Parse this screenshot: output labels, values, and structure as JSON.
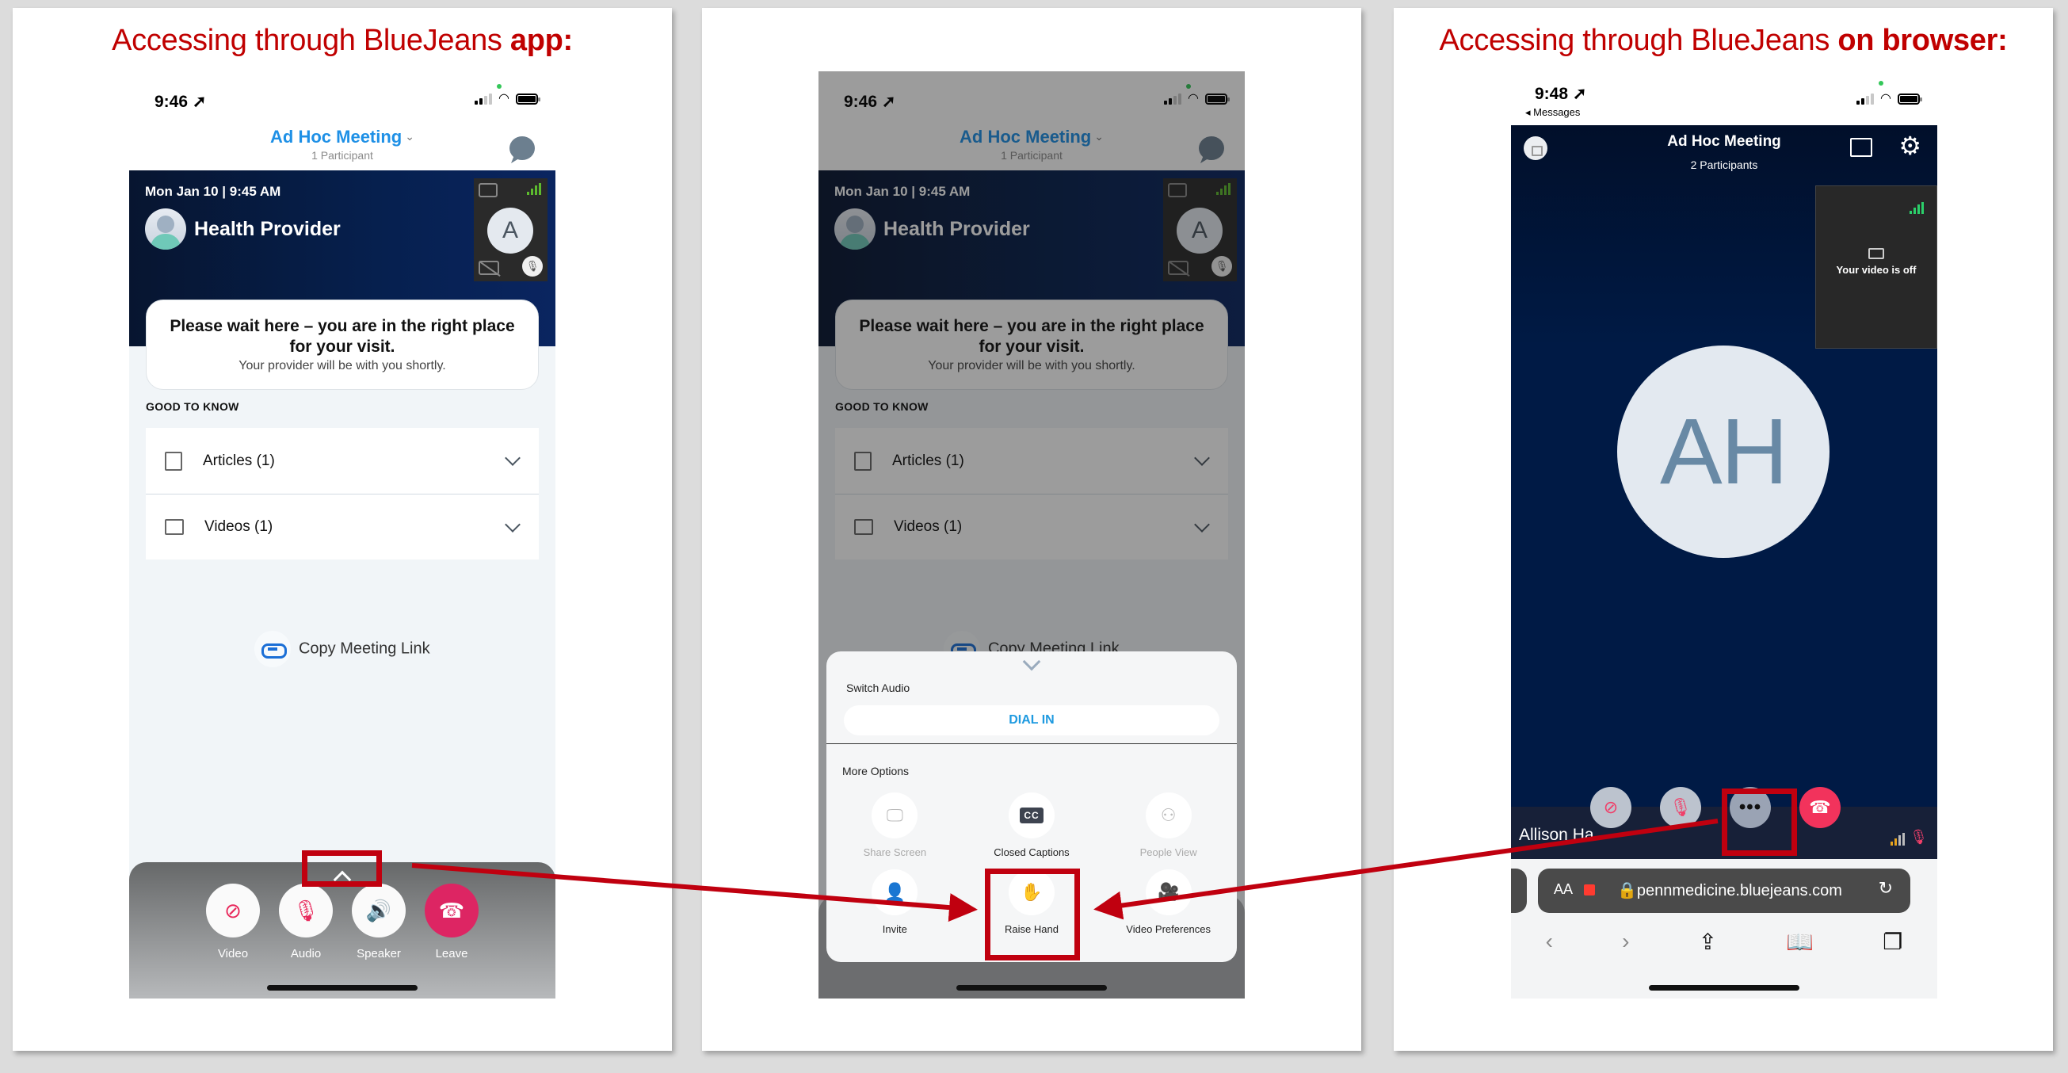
{
  "colors": {
    "annotation_red": "#c0000f",
    "link_blue": "#1e90e6",
    "leave_pink": "#dd2563",
    "meeting_navy": "#001a45"
  },
  "panels": [
    {
      "heading_regular": "Accessing through BlueJeans ",
      "heading_bold": "app:",
      "status": {
        "time": "9:46 ➚"
      },
      "header": {
        "title": "Ad Hoc Meeting",
        "participants": "1 Participant"
      },
      "video": {
        "date": "Mon Jan 10 | 9:45 AM",
        "provider_name": "Health Provider",
        "self_initial": "A"
      },
      "wait_card": {
        "title": "Please wait here – you are in the right place for your visit.",
        "subtitle": "Your provider will be with you shortly."
      },
      "good_to_know": {
        "label": "GOOD TO KNOW",
        "items": [
          {
            "icon": "article-icon",
            "label": "Articles (1)"
          },
          {
            "icon": "video-icon",
            "label": "Videos (1)"
          }
        ]
      },
      "copy_link": "Copy Meeting Link",
      "controls": [
        {
          "icon": "video-off-icon",
          "label": "Video"
        },
        {
          "icon": "mic-off-icon",
          "label": "Audio"
        },
        {
          "icon": "speaker-icon",
          "label": "Speaker"
        },
        {
          "icon": "hang-up-icon",
          "label": "Leave"
        }
      ]
    },
    {
      "heading_regular": "",
      "heading_bold": "",
      "status": {
        "time": "9:46 ➚"
      },
      "header": {
        "title": "Ad Hoc Meeting",
        "participants": "1 Participant"
      },
      "video": {
        "date": "Mon Jan 10 | 9:45 AM",
        "provider_name": "Health Provider",
        "self_initial": "A"
      },
      "wait_card": {
        "title": "Please wait here – you are in the right place for your visit.",
        "subtitle": "Your provider will be with you shortly."
      },
      "good_to_know": {
        "label": "GOOD TO KNOW",
        "items": [
          {
            "icon": "article-icon",
            "label": "Articles (1)"
          },
          {
            "icon": "video-icon",
            "label": "Videos (1)"
          }
        ]
      },
      "copy_link": "Copy Meeting Link",
      "sheet": {
        "switch_audio_label": "Switch Audio",
        "dial_in": "DIAL IN",
        "more_options_label": "More Options",
        "options": [
          {
            "icon": "share-screen-icon",
            "label": "Share Screen",
            "enabled": false
          },
          {
            "icon": "closed-captions-icon",
            "label": "Closed Captions",
            "enabled": true,
            "glyph": "CC"
          },
          {
            "icon": "people-view-icon",
            "label": "People View",
            "enabled": false
          },
          {
            "icon": "invite-icon",
            "label": "Invite",
            "enabled": true
          },
          {
            "icon": "raise-hand-icon",
            "label": "Raise Hand",
            "enabled": true,
            "highlighted": true
          },
          {
            "icon": "video-preferences-icon",
            "label": "Video Preferences",
            "enabled": true
          }
        ]
      }
    },
    {
      "heading_regular": "Accessing through BlueJeans ",
      "heading_bold": "on browser:",
      "status": {
        "time": "9:48 ➚",
        "back_label": "◂ Messages"
      },
      "meeting": {
        "title": "Ad Hoc Meeting",
        "participants": "2 Participants",
        "self_view_text": "Your video is off",
        "avatar_initials": "AH",
        "participant_name": "Allison Ha"
      },
      "controls": [
        {
          "icon": "video-off-icon"
        },
        {
          "icon": "mic-off-icon"
        },
        {
          "icon": "more-options-icon",
          "glyph": "•••",
          "highlighted": true
        },
        {
          "icon": "hang-up-icon"
        }
      ],
      "browser": {
        "aa_label": "AA",
        "url": "🔒pennmedicine.bluejeans.com"
      }
    }
  ]
}
